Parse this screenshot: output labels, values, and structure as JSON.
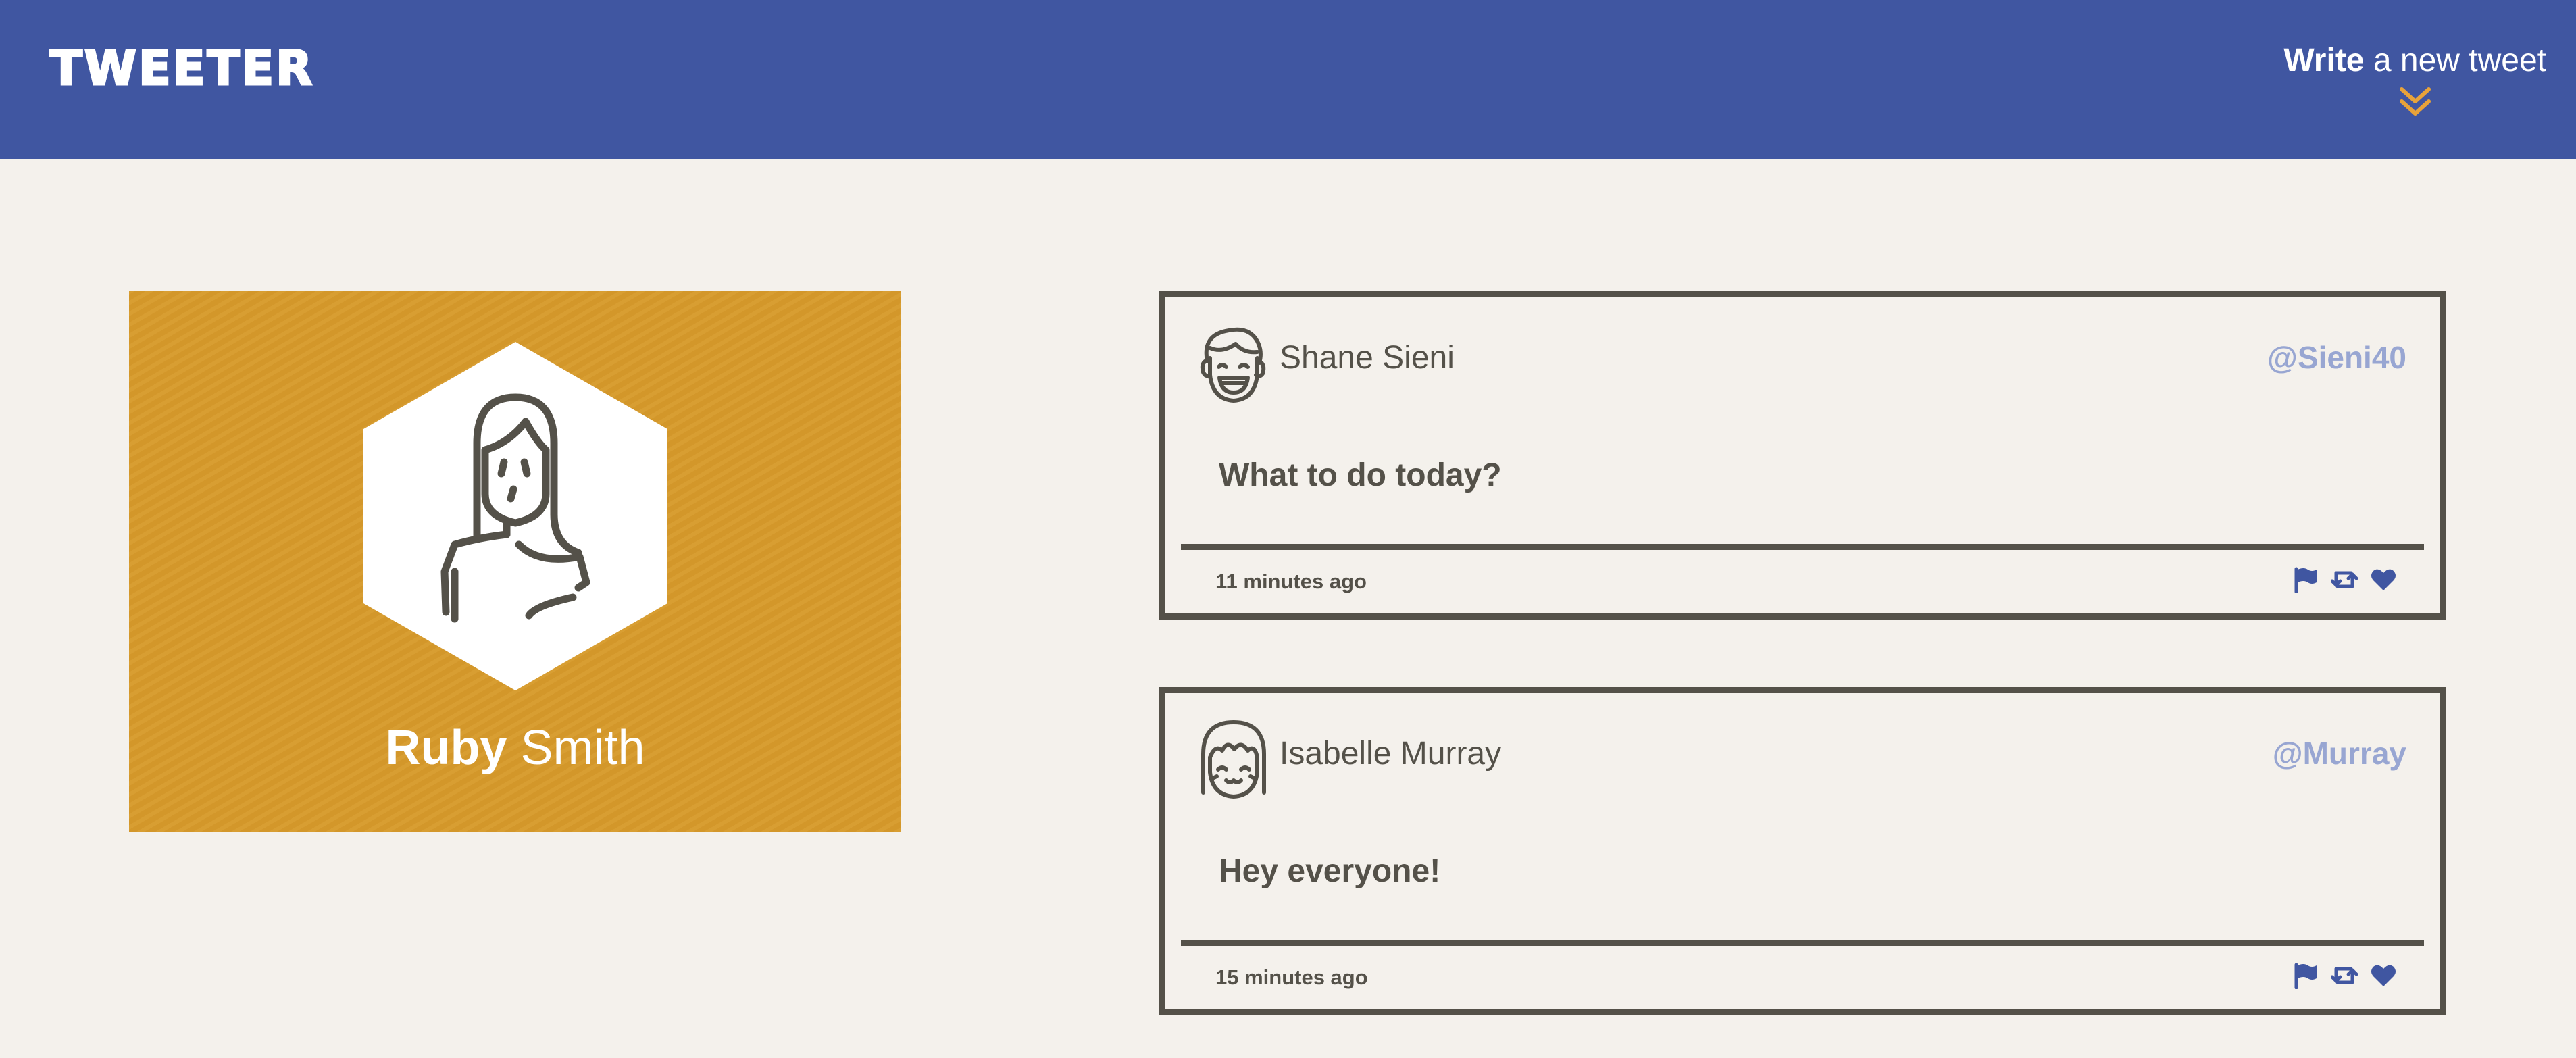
{
  "nav": {
    "logo": "TWEETER",
    "compose": {
      "strong": "Write",
      "light": "a new tweet",
      "arrow_icon": "double-chevron-down-icon",
      "arrow_color": "#e8a33a"
    },
    "background": "#4056a1"
  },
  "profile": {
    "first_name": "Ruby",
    "last_name": "Smith",
    "avatar_icon": "woman-avatar-icon",
    "background": "#d79a2b"
  },
  "tweets": [
    {
      "name": "Shane Sieni",
      "handle": "@Sieni40",
      "avatar_icon": "laughing-man-avatar-icon",
      "body": "What to do today?",
      "time": "11 minutes ago",
      "actions": [
        "flag-icon",
        "retweet-icon",
        "heart-icon"
      ]
    },
    {
      "name": "Isabelle Murray",
      "handle": "@Murray",
      "avatar_icon": "smiling-woman-avatar-icon",
      "body": "Hey everyone!",
      "time": "15 minutes ago",
      "actions": [
        "flag-icon",
        "retweet-icon",
        "heart-icon"
      ]
    }
  ],
  "colors": {
    "page_background": "#f4f1ec",
    "text_dark": "#545149",
    "handle": "#98a6d2",
    "action_icons": "#4056a1"
  }
}
